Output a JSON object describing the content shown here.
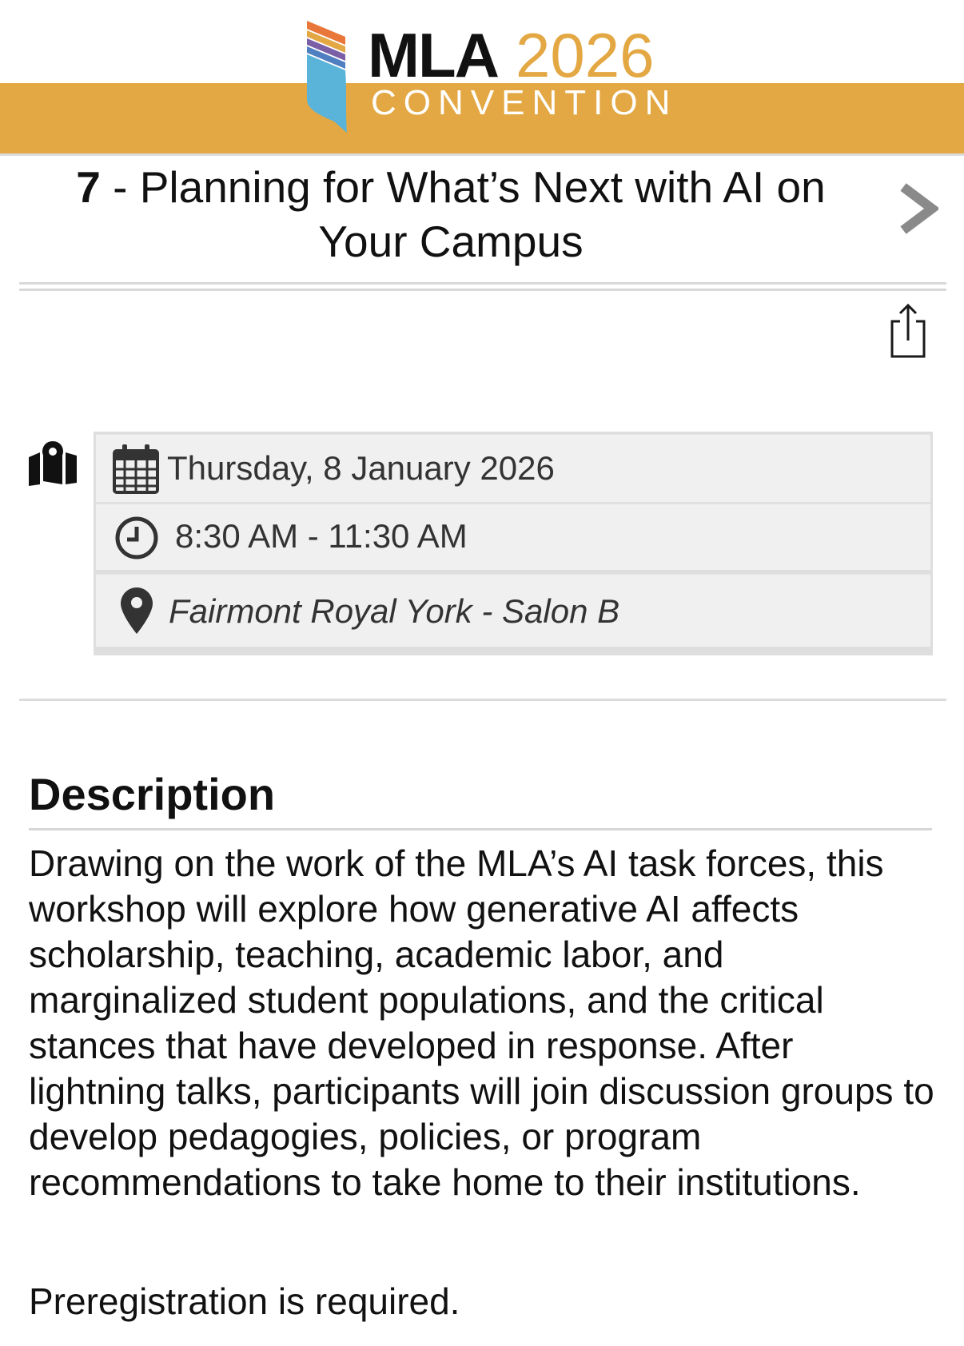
{
  "header": {
    "logo_brand": "MLA",
    "logo_year": "2026",
    "logo_subtitle": "CONVENTION",
    "accent_color": "#e3a843"
  },
  "session": {
    "number": "7",
    "title": " - Planning for What’s Next with AI on Your Campus"
  },
  "icons": {
    "next": "chevron-right-icon",
    "share": "share-icon",
    "map": "map-marker-icon",
    "calendar": "calendar-icon",
    "clock": "clock-icon",
    "location": "location-pin-icon"
  },
  "details": {
    "date": "Thursday, 8 January 2026",
    "time": "8:30 AM - 11:30 AM",
    "location": "Fairmont Royal York - Salon B"
  },
  "description": {
    "heading": "Description",
    "body": "Drawing on the work of the MLA’s AI task forces, this workshop will explore how generative AI affects scholarship, teaching, academic labor, and marginalized student populations, and the critical stances that have developed in response. After lightning talks, participants will join discussion groups to develop pedagogies, policies, or program recommendations to take home to their institutions.",
    "note": "Preregistration is required."
  }
}
